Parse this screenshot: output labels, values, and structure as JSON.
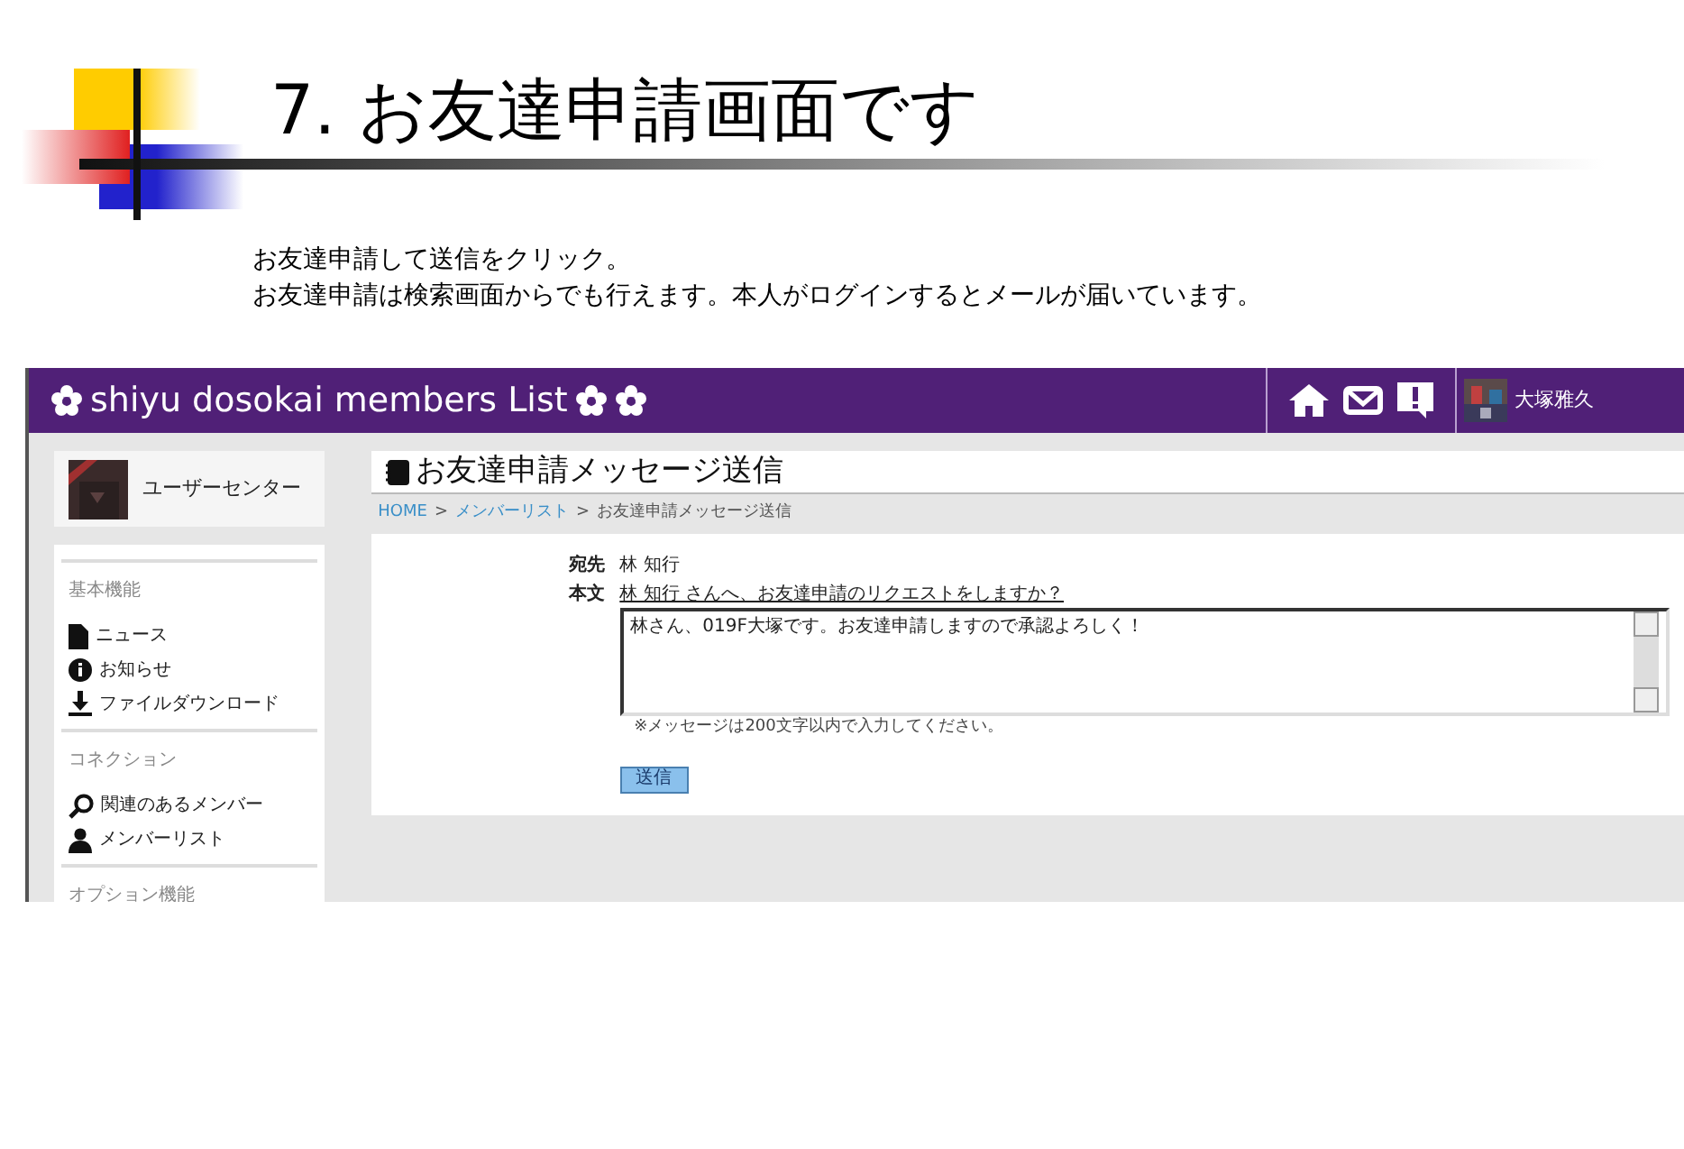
{
  "slide": {
    "title": "7. お友達申請画面です",
    "body": [
      "お友達申請して送信をクリック。",
      "お友達申請は検索画面からでも行えます。本人がログインするとメールが届いています。"
    ]
  },
  "site": {
    "title": "shiyu dosokai members List",
    "user": "大塚雅久"
  },
  "sidebar": {
    "header": "ユーザーセンター",
    "sections": [
      {
        "heading": "基本機能",
        "items": [
          {
            "kind": "document",
            "label": "ニュース"
          },
          {
            "kind": "info",
            "label": "お知らせ"
          },
          {
            "kind": "download",
            "label": "ファイルダウンロード"
          }
        ]
      },
      {
        "heading": "コネクション",
        "items": [
          {
            "kind": "search",
            "label": "関連のあるメンバー"
          },
          {
            "kind": "person",
            "label": "メンバーリスト"
          }
        ]
      },
      {
        "heading": "オプション機能"
      }
    ]
  },
  "page": {
    "title": "お友達申請メッセージ送信",
    "breadcrumb": [
      {
        "label": "HOME",
        "link": true
      },
      {
        "label": ">",
        "link": false
      },
      {
        "label": "メンバーリスト",
        "link": true
      },
      {
        "label": ">",
        "link": false
      },
      {
        "label": "お友達申請メッセージ送信",
        "link": false
      }
    ],
    "to_label": "宛先",
    "to_value": "林 知行",
    "body_label": "本文",
    "prompt": "林 知行 さんへ、お友達申請のリクエストをしますか？",
    "message": "林さん、019F大塚です。お友達申請しますので承認よろしく！",
    "note": "※メッセージは200文字以内で入力してください。",
    "submit": "送信"
  }
}
